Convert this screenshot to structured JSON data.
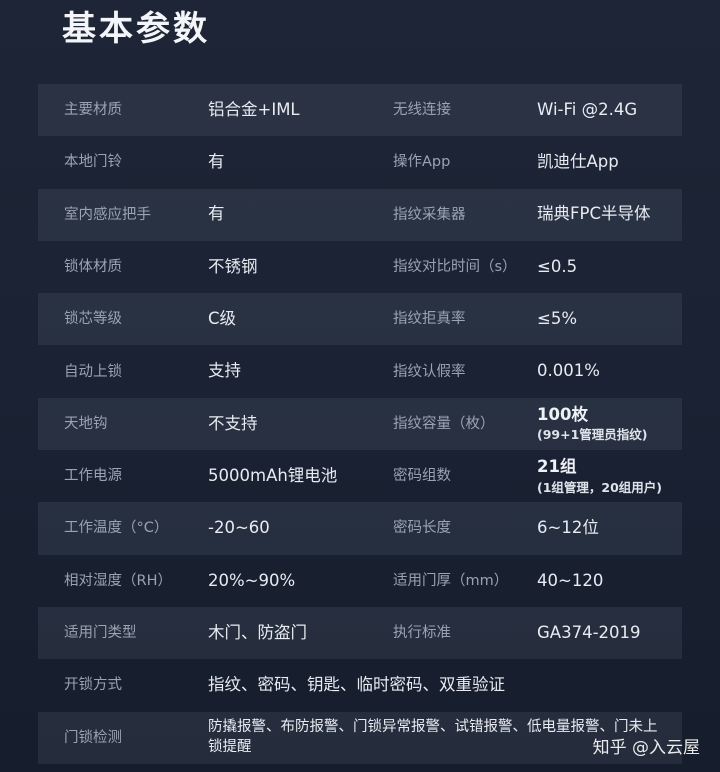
{
  "title": "基本参数",
  "watermark": "知乎 @入云屋",
  "rows": [
    {
      "k1": "主要材质",
      "v1": "铝合金+IML",
      "k2": "无线连接",
      "v2": "Wi-Fi @2.4G"
    },
    {
      "k1": "本地门铃",
      "v1": "有",
      "k2": "操作App",
      "v2": "凯迪仕App"
    },
    {
      "k1": "室内感应把手",
      "v1": "有",
      "k2": "指纹采集器",
      "v2": "瑞典FPC半导体"
    },
    {
      "k1": "锁体材质",
      "v1": "不锈钢",
      "k2": "指纹对比时间（s）",
      "v2": "≤0.5"
    },
    {
      "k1": "锁芯等级",
      "v1": "C级",
      "k2": "指纹拒真率",
      "v2": "≤5%"
    },
    {
      "k1": "自动上锁",
      "v1": "支持",
      "k2": "指纹认假率",
      "v2": "0.001%"
    },
    {
      "k1": "天地钩",
      "v1": "不支持",
      "k2": "指纹容量（枚）",
      "v2": "100枚",
      "v2sub": "(99+1管理员指纹)"
    },
    {
      "k1": "工作电源",
      "v1": "5000mAh锂电池",
      "k2": "密码组数",
      "v2": "21组",
      "v2sub": "(1组管理，20组用户)"
    },
    {
      "k1": "工作温度（°C）",
      "v1": "-20~60",
      "k2": "密码长度",
      "v2": "6~12位"
    },
    {
      "k1": "相对湿度（RH）",
      "v1": "20%~90%",
      "k2": "适用门厚（mm）",
      "v2": "40~120"
    },
    {
      "k1": "适用门类型",
      "v1": "木门、防盗门",
      "k2": "执行标准",
      "v2": "GA374-2019"
    },
    {
      "k1": "开锁方式",
      "v1": "指纹、密码、钥匙、临时密码、双重验证"
    },
    {
      "k1": "门锁检测",
      "v1": "防撬报警、布防报警、门锁异常报警、试错报警、低电量报警、门未上锁提醒"
    }
  ]
}
